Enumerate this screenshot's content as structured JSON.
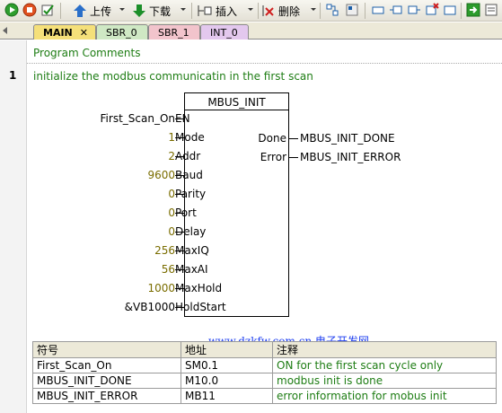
{
  "toolbar": {
    "upload_label": "上传",
    "download_label": "下载",
    "insert_label": "插入",
    "delete_label": "删除"
  },
  "tabs": [
    {
      "label": "MAIN",
      "active": true,
      "color": "#f5e07a"
    },
    {
      "label": "SBR_0",
      "active": false,
      "color": "#cfe8c4"
    },
    {
      "label": "SBR_1",
      "active": false,
      "color": "#f2c4cc"
    },
    {
      "label": "INT_0",
      "active": false,
      "color": "#e3c8ee"
    }
  ],
  "editor": {
    "program_comments": "Program Comments",
    "network_number": "1",
    "network_comment": "initialize the modbus communicatin in the first scan"
  },
  "block": {
    "title": "MBUS_INIT",
    "inputs": [
      {
        "pin": "EN",
        "value": "First_Scan_On"
      },
      {
        "pin": "Mode",
        "value": "1"
      },
      {
        "pin": "Addr",
        "value": "2"
      },
      {
        "pin": "Baud",
        "value": "9600"
      },
      {
        "pin": "Parity",
        "value": "0"
      },
      {
        "pin": "Port",
        "value": "0"
      },
      {
        "pin": "Delay",
        "value": "0"
      },
      {
        "pin": "MaxIQ",
        "value": "256"
      },
      {
        "pin": "MaxAI",
        "value": "56"
      },
      {
        "pin": "MaxHold",
        "value": "1000"
      },
      {
        "pin": "HoldStart",
        "value": "&VB1000"
      }
    ],
    "outputs": [
      {
        "pin": "Done",
        "value": "MBUS_INIT_DONE"
      },
      {
        "pin": "Error",
        "value": "MBUS_INIT_ERROR"
      }
    ]
  },
  "watermark": "www.dzkfw.com.cn 电子开发网",
  "symbol_table": {
    "headers": [
      "符号",
      "地址",
      "注释"
    ],
    "rows": [
      [
        "First_Scan_On",
        "SM0.1",
        "ON for the first scan cycle only"
      ],
      [
        "MBUS_INIT_DONE",
        "M10.0",
        "modbus init is done"
      ],
      [
        "MBUS_INIT_ERROR",
        "MB11",
        "error information for mobus init"
      ]
    ]
  },
  "colors": {
    "comment_green": "#1e7d14",
    "constant_olive": "#7a6d00",
    "watermark_blue": "#1c3df0"
  }
}
